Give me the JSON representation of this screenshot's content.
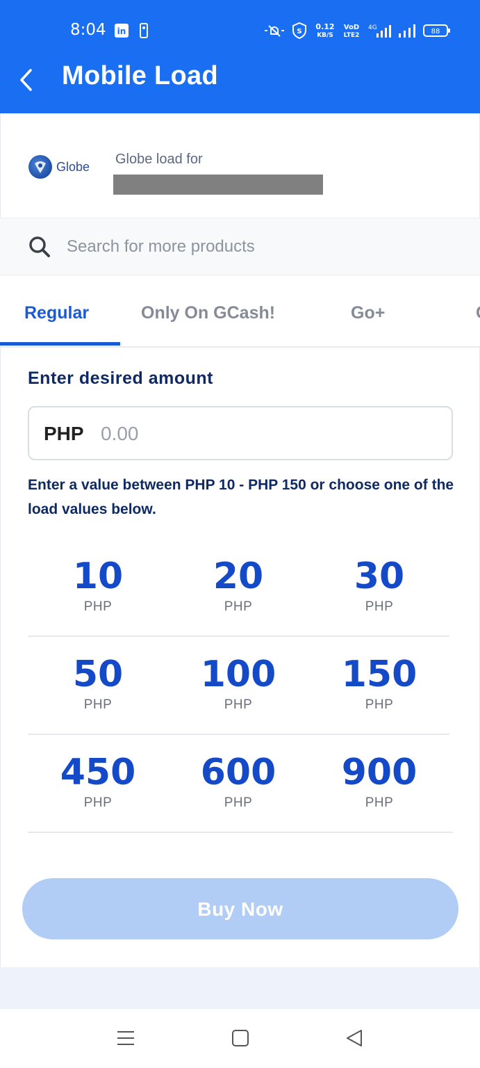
{
  "status_bar": {
    "time": "8:04",
    "speed_value": "0.12",
    "speed_unit": "KB/S",
    "volte_top": "VoD",
    "volte_bottom": "LTE2",
    "network": "4G",
    "battery": "88"
  },
  "header": {
    "title": "Mobile Load",
    "back_icon": "chevron-left-icon",
    "background": "#1a6ef2"
  },
  "provider": {
    "logo_text": "Globe",
    "load_for_label": "Globe load for"
  },
  "search": {
    "placeholder": "Search for more products",
    "icon": "search-icon"
  },
  "tabs": [
    {
      "label": "Regular",
      "active": true
    },
    {
      "label": "Only On GCash!",
      "active": false
    },
    {
      "label": "Go+",
      "active": false
    }
  ],
  "amount": {
    "label": "Enter desired amount",
    "currency": "PHP",
    "placeholder": "0.00",
    "helper": "Enter a value between PHP 10 - PHP 150 or choose one of the load values below."
  },
  "load_values": [
    {
      "value": "10",
      "currency": "PHP"
    },
    {
      "value": "20",
      "currency": "PHP"
    },
    {
      "value": "30",
      "currency": "PHP"
    },
    {
      "value": "50",
      "currency": "PHP"
    },
    {
      "value": "100",
      "currency": "PHP"
    },
    {
      "value": "150",
      "currency": "PHP"
    },
    {
      "value": "450",
      "currency": "PHP"
    },
    {
      "value": "600",
      "currency": "PHP"
    },
    {
      "value": "900",
      "currency": "PHP"
    }
  ],
  "buy_button": {
    "label": "Buy Now",
    "enabled": false
  },
  "colors": {
    "accent": "#1b5ad6",
    "value_text": "#1449c8",
    "disabled_button": "#b1cdf6"
  }
}
